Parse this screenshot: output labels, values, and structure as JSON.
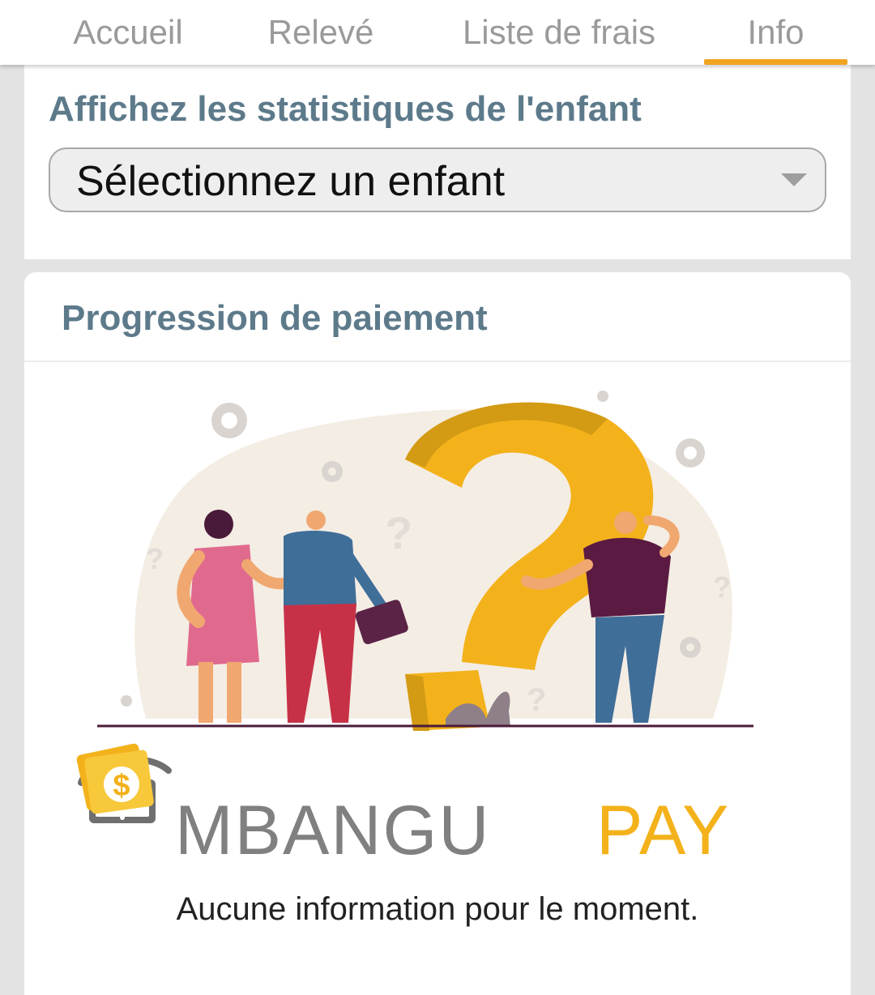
{
  "tabs": [
    {
      "label": "Accueil"
    },
    {
      "label": "Relevé"
    },
    {
      "label": "Liste de frais"
    },
    {
      "label": "Info"
    }
  ],
  "active_tab": "Info",
  "stats": {
    "heading": "Affichez les statistiques de l'enfant",
    "select_value": "Sélectionnez un enfant"
  },
  "payment": {
    "heading": "Progression de paiement",
    "empty_message": "Aucune information pour le moment."
  },
  "brand": {
    "name_part1": "MBANGU",
    "name_part2": "PAY",
    "coin_symbol": "$"
  },
  "colors": {
    "accent": "#f0a422",
    "heading": "#5d7a8b",
    "brand_gray": "#808080",
    "brand_orange": "#f3b21b"
  }
}
